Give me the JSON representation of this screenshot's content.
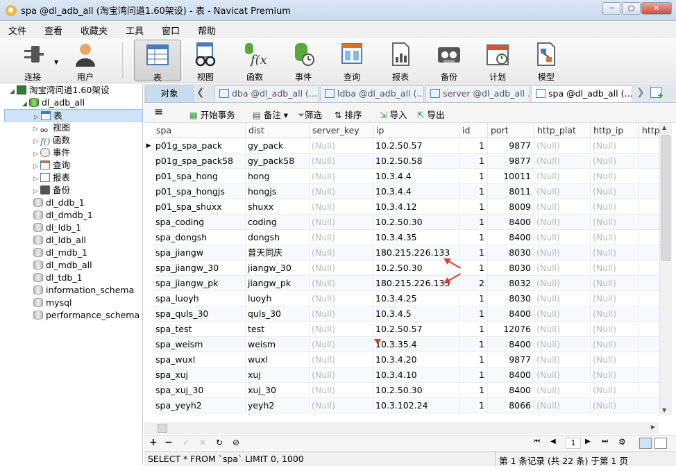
{
  "window": {
    "title": "spa @dl_adb_all (淘宝湾问道1.60架设) - 表 - Navicat Premium",
    "min": "─",
    "max": "□",
    "close": "✕"
  },
  "menu": [
    "文件",
    "查看",
    "收藏夹",
    "工具",
    "窗口",
    "帮助"
  ],
  "toolbar": [
    {
      "label": "连接",
      "icon": "plug-icon"
    },
    {
      "label": "用户",
      "icon": "user-icon"
    },
    {
      "label": "表",
      "icon": "table-icon"
    },
    {
      "label": "视图",
      "icon": "view-icon"
    },
    {
      "label": "函数",
      "icon": "function-icon"
    },
    {
      "label": "事件",
      "icon": "event-icon"
    },
    {
      "label": "查询",
      "icon": "query-icon"
    },
    {
      "label": "报表",
      "icon": "report-icon"
    },
    {
      "label": "备份",
      "icon": "backup-icon"
    },
    {
      "label": "计划",
      "icon": "schedule-icon"
    },
    {
      "label": "模型",
      "icon": "model-icon"
    }
  ],
  "sidebar": {
    "connection": "淘宝湾问道1.60架设",
    "active_db": "dl_adb_all",
    "db_children": [
      "表",
      "视图",
      "函数",
      "事件",
      "查询",
      "报表",
      "备份"
    ],
    "databases": [
      "dl_ddb_1",
      "dl_dmdb_1",
      "dl_ldb_1",
      "dl_ldb_all",
      "dl_mdb_1",
      "dl_mdb_all",
      "dl_tdb_1",
      "information_schema",
      "mysql",
      "performance_schema"
    ]
  },
  "tabs": {
    "objects": "对象",
    "open": [
      "dba @dl_adb_all (...",
      "ldba @dl_adb_all (...",
      "server @dl_adb_all ...",
      "spa @dl_adb_all (..."
    ]
  },
  "subtool": {
    "menu": "≡",
    "begin_tx": "开始事务",
    "memo": "备注",
    "filter": "筛选",
    "sort": "排序",
    "import": "导入",
    "export": "导出"
  },
  "grid": {
    "columns": [
      "spa",
      "dist",
      "server_key",
      "ip",
      "id",
      "port",
      "http_plat",
      "http_ip",
      "http"
    ],
    "null_text": "(Null)",
    "rows": [
      [
        "p01g_spa_pack",
        "gy_pack",
        "10.2.50.57",
        "1",
        "9877"
      ],
      [
        "p01g_spa_pack58",
        "gy_pack58",
        "10.2.50.58",
        "1",
        "9877"
      ],
      [
        "p01_spa_hong",
        "hong",
        "10.3.4.4",
        "1",
        "10011"
      ],
      [
        "p01_spa_hongjs",
        "hongjs",
        "10.3.4.4",
        "1",
        "8011"
      ],
      [
        "p01_spa_shuxx",
        "shuxx",
        "10.3.4.12",
        "1",
        "8009"
      ],
      [
        "spa_coding",
        "coding",
        "10.2.50.30",
        "1",
        "8400"
      ],
      [
        "spa_dongsh",
        "dongsh",
        "10.3.4.35",
        "1",
        "8400"
      ],
      [
        "spa_jiangw",
        "普天同庆",
        "180.215.226.133",
        "1",
        "8030"
      ],
      [
        "spa_jiangw_30",
        "jiangw_30",
        "10.2.50.30",
        "1",
        "8030"
      ],
      [
        "spa_jiangw_pk",
        "jiangw_pk",
        "180.215.226.133",
        "2",
        "8032"
      ],
      [
        "spa_luoyh",
        "luoyh",
        "10.3.4.25",
        "1",
        "8030"
      ],
      [
        "spa_quls_30",
        "quls_30",
        "10.3.4.5",
        "1",
        "8400"
      ],
      [
        "spa_test",
        "test",
        "10.2.50.57",
        "1",
        "12076"
      ],
      [
        "spa_weism",
        "weism",
        "10.3.35.4",
        "1",
        "8400"
      ],
      [
        "spa_wuxl",
        "wuxl",
        "10.3.4.20",
        "1",
        "9877"
      ],
      [
        "spa_xuj",
        "xuj",
        "10.3.4.10",
        "1",
        "8400"
      ],
      [
        "spa_xuj_30",
        "xuj_30",
        "10.2.50.30",
        "1",
        "8400"
      ],
      [
        "spa_yeyh2",
        "yeyh2",
        "10.3.102.24",
        "1",
        "8066"
      ]
    ]
  },
  "nav": {
    "page": "1"
  },
  "status": {
    "sql": "SELECT * FROM `spa` LIMIT 0, 1000",
    "records": "第 1 条记录 (共 22 条) 于第 1 页"
  },
  "colors": {
    "accent": "#c9dbef",
    "arrow": "#e23a2a",
    "null": "#b8b8b8"
  }
}
